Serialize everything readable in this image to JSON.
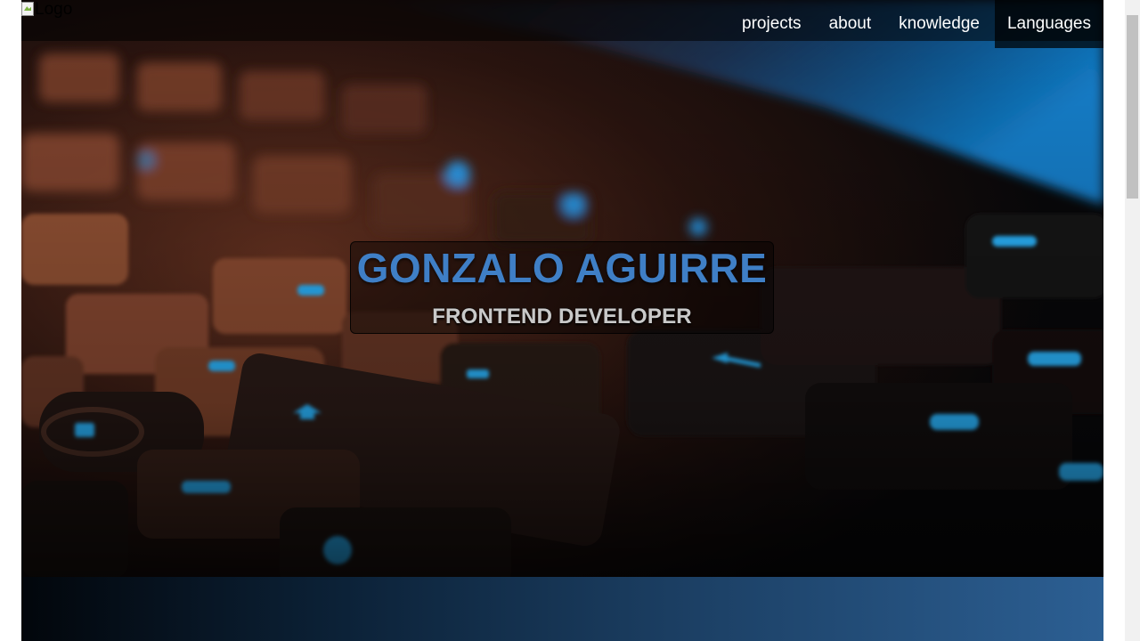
{
  "header": {
    "logo_alt": "Logo",
    "nav": [
      {
        "label": "projects"
      },
      {
        "label": "about"
      },
      {
        "label": "knowledge"
      },
      {
        "label": "Languages"
      }
    ]
  },
  "hero": {
    "name": "GONZALO AGUIRRE",
    "role": "FRONTEND DEVELOPER",
    "background": "keyboard-photo"
  },
  "colors": {
    "name_blue": "#3f7fc6",
    "section_gradient_start": "#02060b",
    "section_gradient_end": "#2c5f93",
    "nav_text": "#ffffff"
  }
}
